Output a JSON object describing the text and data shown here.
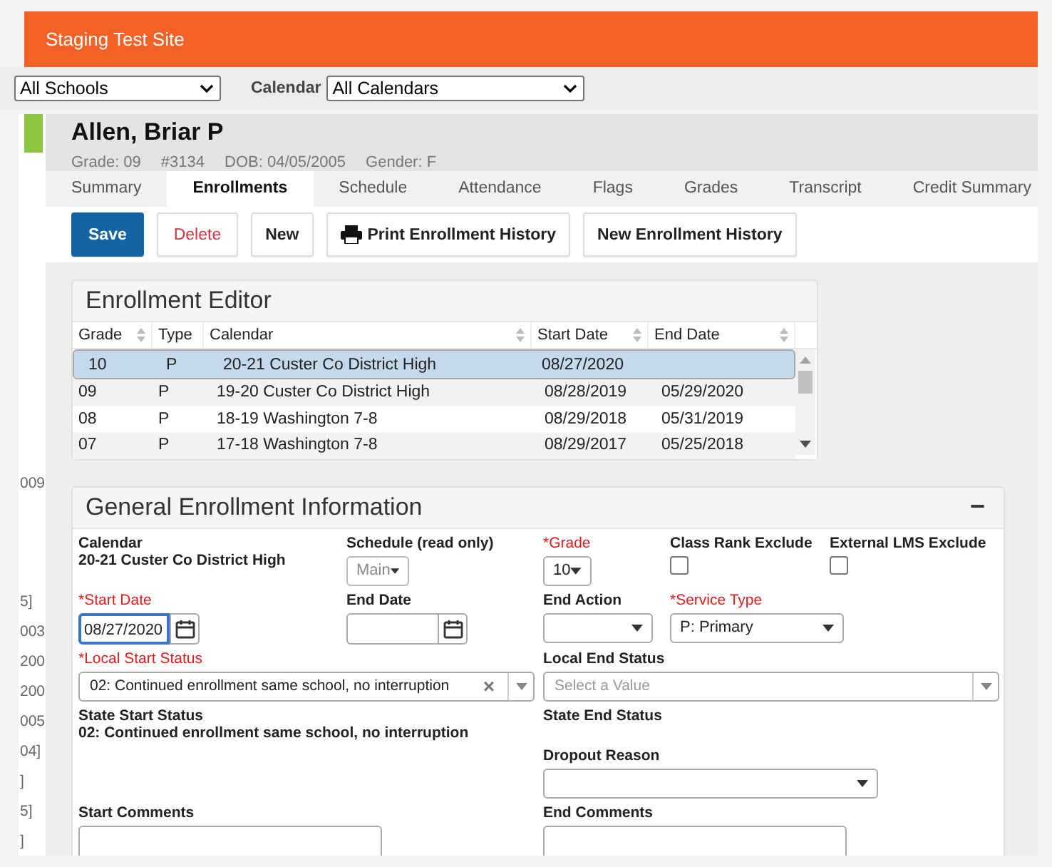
{
  "site_title": "Staging Test Site",
  "school_select": {
    "value": "All Schools"
  },
  "calendar_select": {
    "label": "Calendar",
    "value": "All Calendars"
  },
  "sidebar_fragments": [
    "009",
    "5]",
    "003",
    "200",
    "200",
    "005",
    "04]",
    "]",
    "5]",
    "]"
  ],
  "student": {
    "name": "Allen, Briar P",
    "details": [
      "Grade: 09",
      "#3134",
      "DOB: 04/05/2005",
      "Gender: F"
    ]
  },
  "tabs": [
    {
      "label": "Summary",
      "selected": false
    },
    {
      "label": "Enrollments",
      "selected": true
    },
    {
      "label": "Schedule",
      "selected": false
    },
    {
      "label": "Attendance",
      "selected": false
    },
    {
      "label": "Flags",
      "selected": false
    },
    {
      "label": "Grades",
      "selected": false
    },
    {
      "label": "Transcript",
      "selected": false
    },
    {
      "label": "Credit Summary",
      "selected": false
    }
  ],
  "buttons": [
    {
      "label": "Save",
      "kind": "primary"
    },
    {
      "label": "Delete",
      "kind": "danger"
    },
    {
      "label": "New",
      "kind": "default"
    },
    {
      "label": "Print Enrollment History",
      "kind": "print"
    },
    {
      "label": "New Enrollment History",
      "kind": "default"
    }
  ],
  "enrollment_editor": {
    "title": "Enrollment Editor",
    "columns": [
      {
        "label": "Grade",
        "sortable": true
      },
      {
        "label": "Type",
        "sortable": false
      },
      {
        "label": "Calendar",
        "sortable": true
      },
      {
        "label": "Start Date",
        "sortable": true
      },
      {
        "label": "End Date",
        "sortable": true
      }
    ],
    "rows": [
      {
        "cells": [
          "10",
          "P",
          "20-21 Custer Co District High",
          "08/27/2020",
          ""
        ],
        "selected": true
      },
      {
        "cells": [
          "09",
          "P",
          "19-20 Custer Co District High",
          "08/28/2019",
          "05/29/2020"
        ],
        "selected": false
      },
      {
        "cells": [
          "08",
          "P",
          "18-19 Washington 7-8",
          "08/29/2018",
          "05/31/2019"
        ],
        "selected": false
      },
      {
        "cells": [
          "07",
          "P",
          "17-18 Washington 7-8",
          "08/29/2017",
          "05/25/2018"
        ],
        "selected": false
      }
    ]
  },
  "general": {
    "title": "General Enrollment Information",
    "collapse_symbol": "−",
    "calendar": {
      "label": "Calendar",
      "value": "20-21 Custer Co District High"
    },
    "schedule": {
      "label": "Schedule (read only)",
      "value": "Main",
      "disabled": true
    },
    "grade": {
      "label": "*Grade",
      "required": true,
      "value": "10"
    },
    "class_rank_exclude": {
      "label": "Class Rank Exclude",
      "checked": false
    },
    "external_lms_exclude": {
      "label": "External LMS Exclude",
      "checked": false
    },
    "start_date": {
      "label": "*Start Date",
      "required": true,
      "value": "08/27/2020",
      "focused": true
    },
    "end_date": {
      "label": "End Date",
      "required": false
    },
    "end_action": {
      "label": "End Action"
    },
    "service_type": {
      "label": "*Service Type",
      "required": true,
      "value": "P: Primary"
    },
    "local_start_status": {
      "label": "*Local Start Status",
      "required": true,
      "value": "02: Continued enrollment same school, no interruption",
      "clear_symbol": "×"
    },
    "local_end_status": {
      "label": "Local End Status",
      "placeholder": "Select a Value"
    },
    "state_start_status": {
      "label": "State Start Status",
      "value": "02: Continued enrollment same school, no interruption"
    },
    "state_end_status": {
      "label": "State End Status"
    },
    "dropout_reason": {
      "label": "Dropout Reason"
    },
    "start_comments": {
      "label": "Start Comments"
    },
    "end_comments": {
      "label": "End Comments"
    }
  }
}
